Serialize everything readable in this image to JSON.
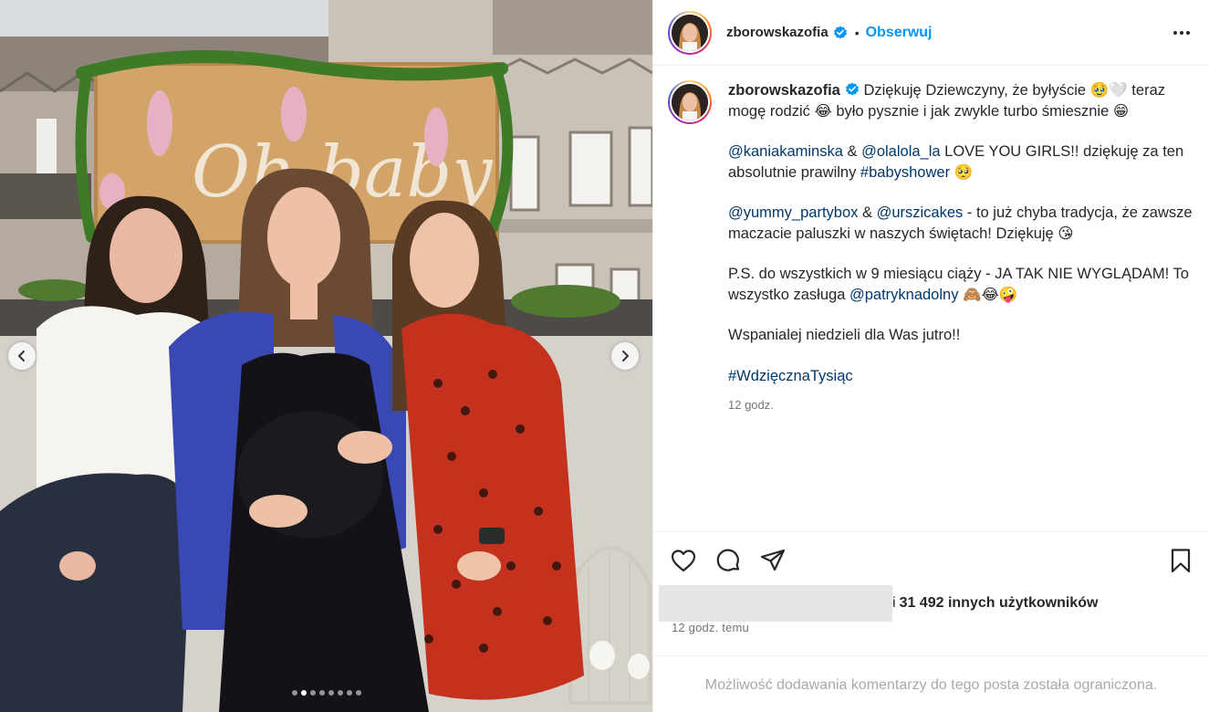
{
  "photo": {
    "nav_prev_icon": "chevron-left-icon",
    "nav_next_icon": "chevron-right-icon",
    "sign_text": "Oh baby",
    "carousel": {
      "total": 8,
      "active": 1
    }
  },
  "header": {
    "username": "zborowskazofia",
    "separator": "•",
    "follow_label": "Obserwuj",
    "verified_icon": "verified-badge-icon",
    "more_icon": "more-options-icon"
  },
  "caption": {
    "username": "zborowskazofia",
    "line1": "Dziękuję Dziewczyny, że byłyście 🥹🤍 teraz mogę rodzić 😂 było pysznie i jak zwykle turbo śmiesznie 😁",
    "p2_mention1": "@kaniakaminska",
    "p2_amp": " & ",
    "p2_mention2": "@olalola_la",
    "p2_text": " LOVE YOU GIRLS!! dziękuję za ten absolutnie prawilny ",
    "p2_hashtag": "#babyshower",
    "p2_end": " 🥺",
    "p3_mention1": "@yummy_partybox",
    "p3_amp": " & ",
    "p3_mention2": "@urszicakes",
    "p3_text": " - to już chyba tradycja, że zawsze maczacie paluszki w naszych świętach! Dziękuję 😘",
    "p4_text": "P.S. do wszystkich w 9 miesiącu ciąży - JA TAK NIE WYGLĄDAM! To wszystko zasługa ",
    "p4_mention": "@patryknadolny",
    "p4_end": " 🙈😂🤪",
    "p5_text": "Wspanialej niedzieli dla Was jutro!!",
    "hashtag": "#WdzięcznaTysiąc",
    "time": "12 godz."
  },
  "actions": {
    "like_icon": "heart-icon",
    "comment_icon": "comment-icon",
    "share_icon": "share-icon",
    "save_icon": "bookmark-icon",
    "likes_separator": "i",
    "likes_text": "31 492 innych użytkowników",
    "post_time": "12 godz. temu",
    "comments_disabled": "Możliwość dodawania komentarzy do tego posta została ograniczona."
  },
  "colors": {
    "link": "#00376b",
    "follow": "#0095f6",
    "muted": "#737373",
    "verified": "#0095f6"
  }
}
